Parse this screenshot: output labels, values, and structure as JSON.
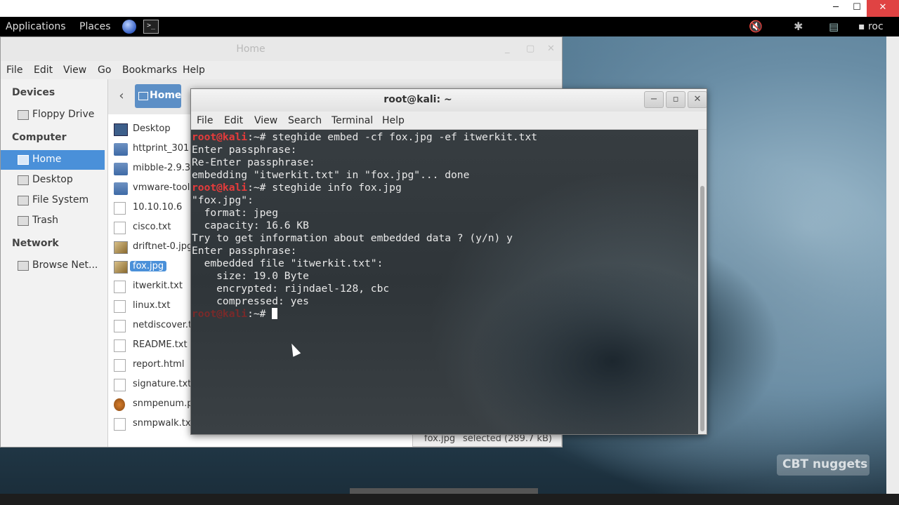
{
  "host": {
    "minimize": "─",
    "maximize": "☐",
    "close": "✕"
  },
  "panel": {
    "applications": "Applications",
    "places": "Places",
    "terminal_icon": ">_",
    "volume_icon": "🔇",
    "bluetooth_icon": "✱",
    "network_icon": "▤",
    "user": "roc"
  },
  "nautilus": {
    "title": "Home",
    "window_buttons": {
      "minimize": "_",
      "maximize": "▢",
      "close": "✕"
    },
    "menu": [
      "File",
      "Edit",
      "View",
      "Go",
      "Bookmarks",
      "Help"
    ],
    "sidebar": {
      "devices_heading": "Devices",
      "floppy": "Floppy Drive",
      "computer_heading": "Computer",
      "home": "Home",
      "desktop": "Desktop",
      "filesystem": "File System",
      "trash": "Trash",
      "network_heading": "Network",
      "browse_network": "Browse Net..."
    },
    "toolbar": {
      "back": "‹",
      "location": "Home"
    },
    "files": [
      {
        "name": "Desktop",
        "icon": "desktop-folder-icon"
      },
      {
        "name": "httprint_301",
        "icon": "folder-icon"
      },
      {
        "name": "mibble-2.9.3",
        "icon": "folder-icon"
      },
      {
        "name": "vmware-tool",
        "icon": "folder-icon"
      },
      {
        "name": "10.10.10.6",
        "icon": "document-icon"
      },
      {
        "name": "cisco.txt",
        "icon": "document-icon"
      },
      {
        "name": "driftnet-0.jpg",
        "icon": "image-icon"
      },
      {
        "name": "fox.jpg",
        "icon": "image-icon"
      },
      {
        "name": "itwerkit.txt",
        "icon": "document-icon"
      },
      {
        "name": "linux.txt",
        "icon": "document-icon"
      },
      {
        "name": "netdiscover.t",
        "icon": "document-icon"
      },
      {
        "name": "README.txt",
        "icon": "document-icon"
      },
      {
        "name": "report.html",
        "icon": "document-icon"
      },
      {
        "name": "signature.txt",
        "icon": "document-icon"
      },
      {
        "name": "snmpenum.pl",
        "icon": "perl-script-icon"
      },
      {
        "name": "snmpwalk.tx",
        "icon": "document-icon"
      }
    ],
    "status": {
      "file": "fox.jpg",
      "selected": "selected (289.7 kB)"
    }
  },
  "terminal": {
    "title": "root@kali: ~",
    "window_buttons": {
      "minimize": "−",
      "maximize": "▫",
      "close": "✕"
    },
    "menu": [
      "File",
      "Edit",
      "View",
      "Search",
      "Terminal",
      "Help"
    ],
    "prompt_user": "root@kali",
    "prompt_path": ":~# ",
    "lines": {
      "l1_cmd": "steghide embed -cf fox.jpg -ef itwerkit.txt",
      "l2": "Enter passphrase:",
      "l3": "Re-Enter passphrase:",
      "l4": "embedding \"itwerkit.txt\" in \"fox.jpg\"... done",
      "l5_cmd": "steghide info fox.jpg",
      "l6": "\"fox.jpg\":",
      "l7": "  format: jpeg",
      "l8": "  capacity: 16.6 KB",
      "l9": "Try to get information about embedded data ? (y/n) y",
      "l10": "Enter passphrase:",
      "l11": "  embedded file \"itwerkit.txt\":",
      "l12": "    size: 19.0 Byte",
      "l13": "    encrypted: rijndael-128, cbc",
      "l14": "    compressed: yes"
    }
  },
  "watermark": "CBT nuggets"
}
